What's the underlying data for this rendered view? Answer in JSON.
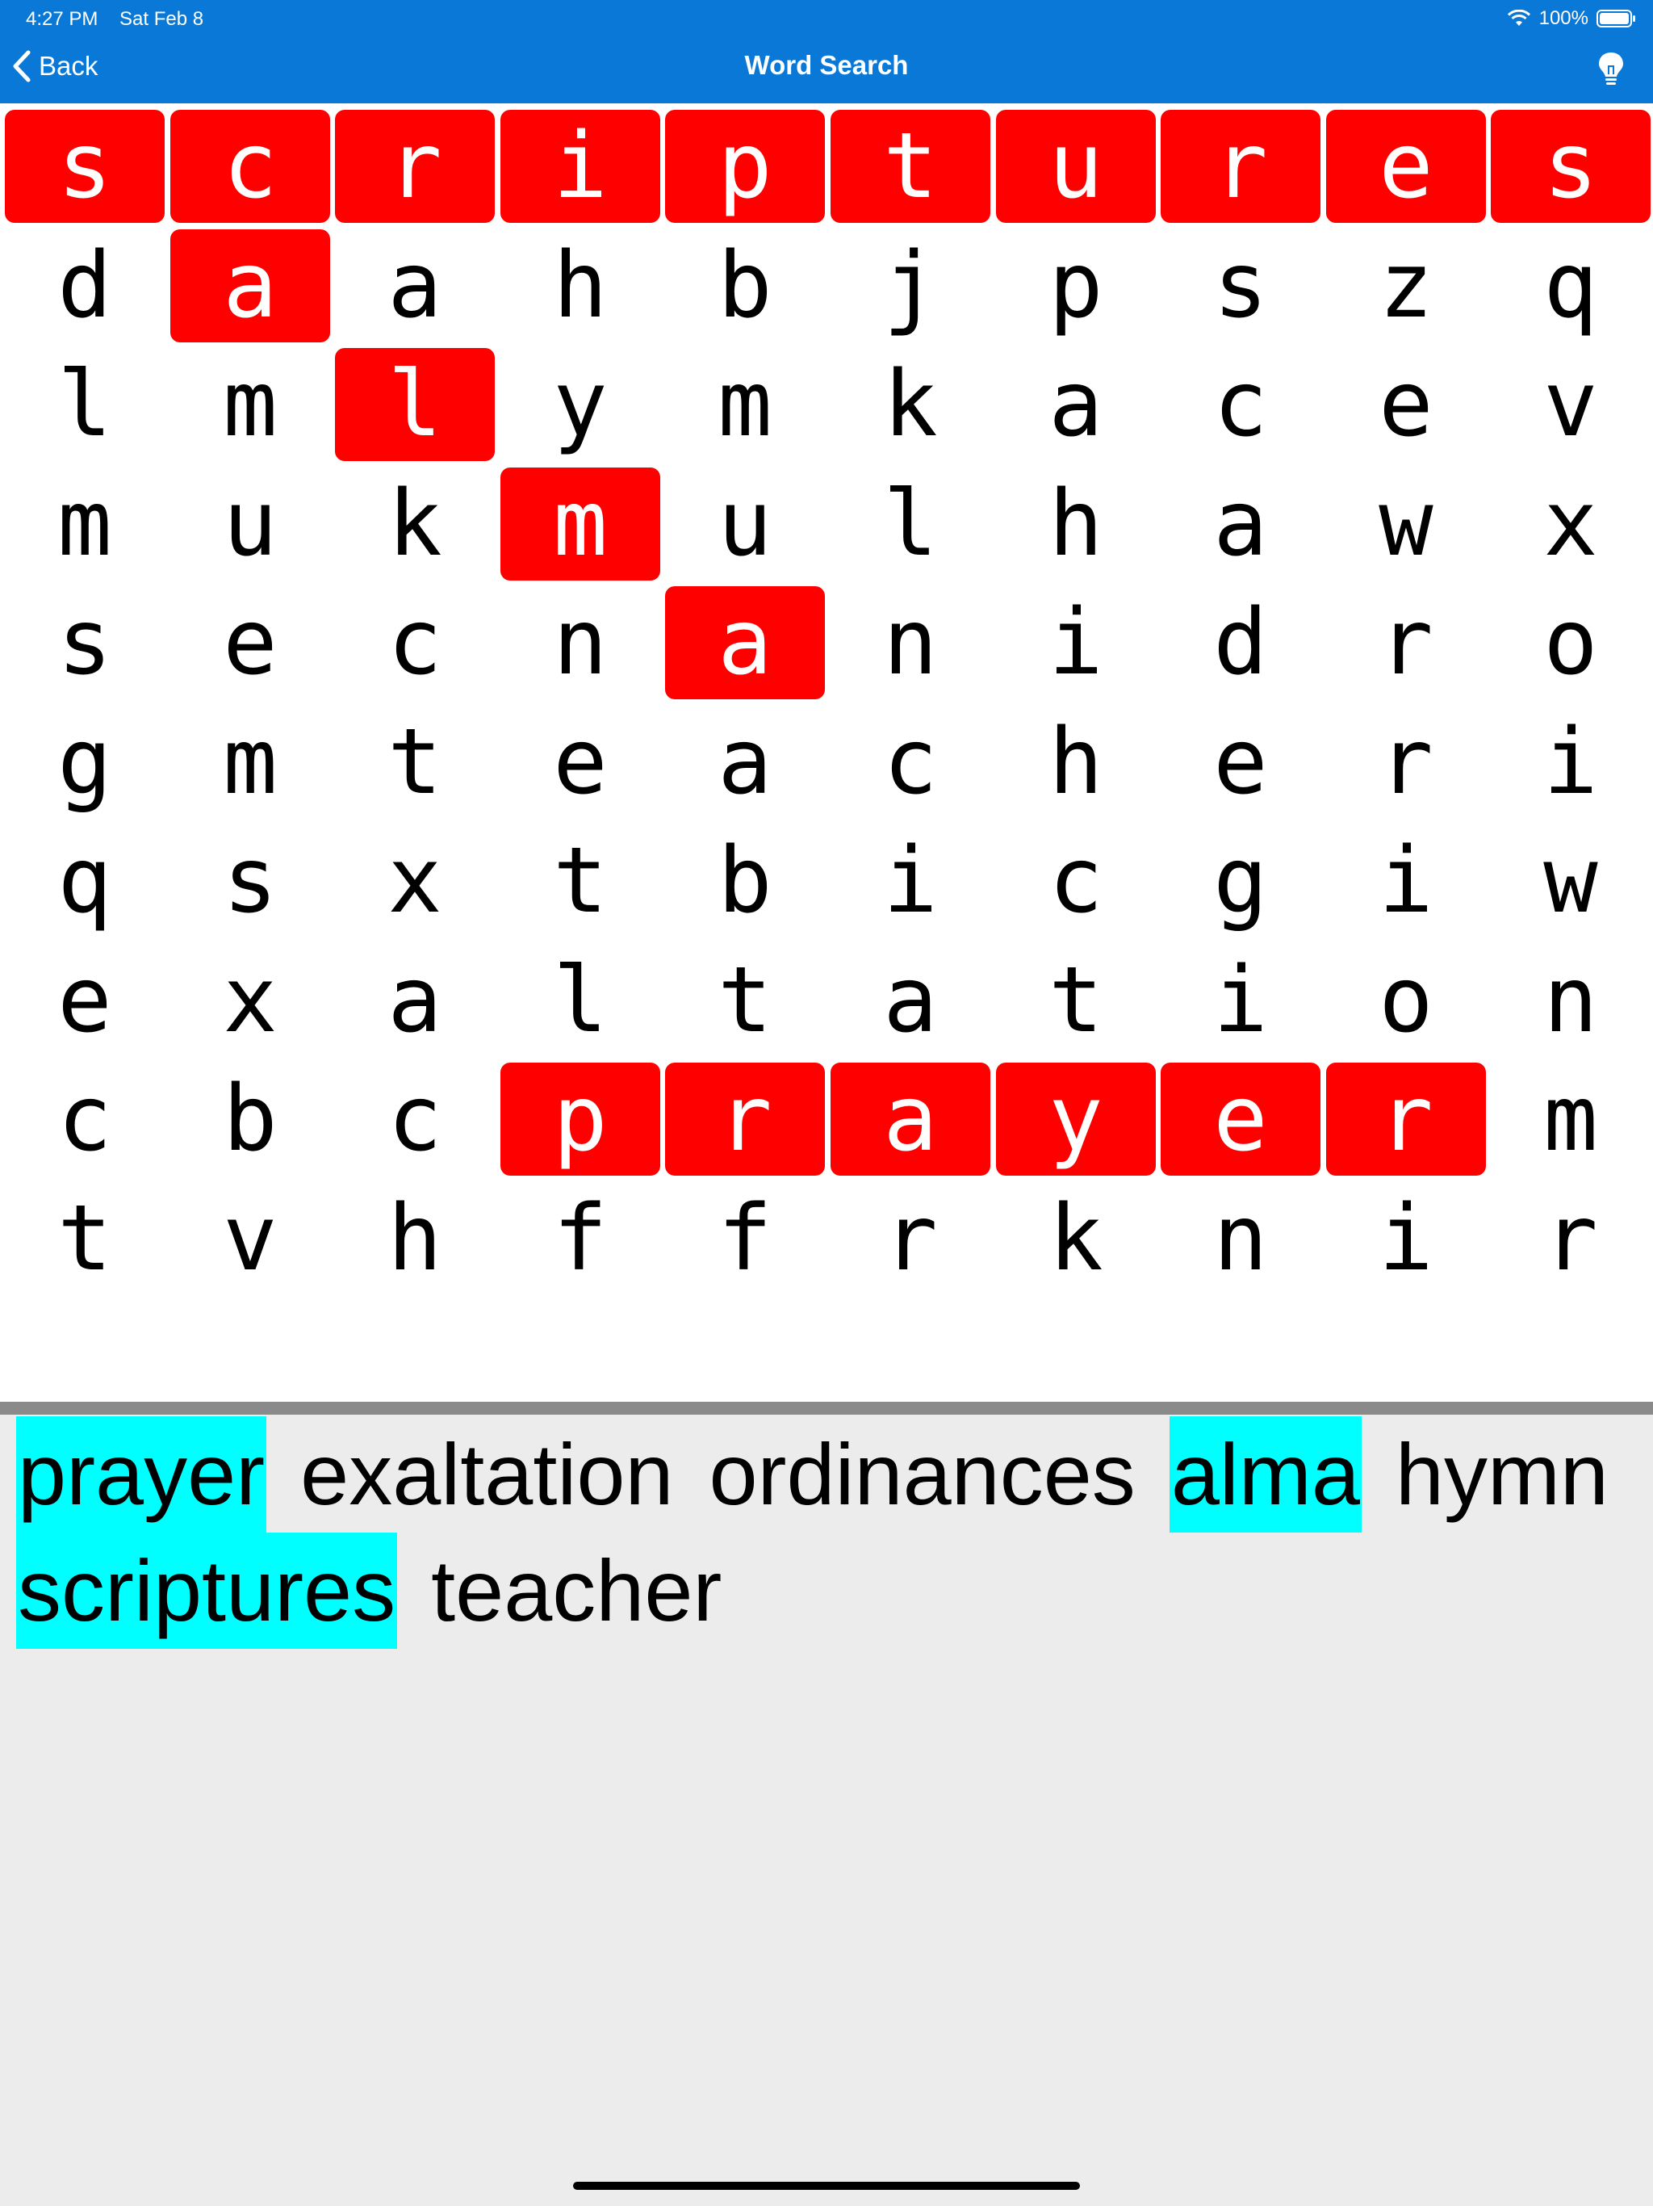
{
  "status_bar": {
    "time": "4:27 PM",
    "date": "Sat Feb 8",
    "battery": "100%",
    "battery_level": 1.0
  },
  "nav": {
    "back_label": "Back",
    "title": "Word Search",
    "hint_icon": "lightbulb-icon"
  },
  "colors": {
    "nav_bar": "#0a78d7",
    "found_cell": "#fe0000",
    "found_word": "#00ffff",
    "word_panel": "#ececec"
  },
  "grid": {
    "rows": [
      [
        "s",
        "c",
        "r",
        "i",
        "p",
        "t",
        "u",
        "r",
        "e",
        "s"
      ],
      [
        "d",
        "a",
        "a",
        "h",
        "b",
        "j",
        "p",
        "s",
        "z",
        "q"
      ],
      [
        "l",
        "m",
        "l",
        "y",
        "m",
        "k",
        "a",
        "c",
        "e",
        "v"
      ],
      [
        "m",
        "u",
        "k",
        "m",
        "u",
        "l",
        "h",
        "a",
        "w",
        "x"
      ],
      [
        "s",
        "e",
        "c",
        "n",
        "a",
        "n",
        "i",
        "d",
        "r",
        "o"
      ],
      [
        "g",
        "m",
        "t",
        "e",
        "a",
        "c",
        "h",
        "e",
        "r",
        "i"
      ],
      [
        "q",
        "s",
        "x",
        "t",
        "b",
        "i",
        "c",
        "g",
        "i",
        "w"
      ],
      [
        "e",
        "x",
        "a",
        "l",
        "t",
        "a",
        "t",
        "i",
        "o",
        "n"
      ],
      [
        "c",
        "b",
        "c",
        "p",
        "r",
        "a",
        "y",
        "e",
        "r",
        "m"
      ],
      [
        "t",
        "v",
        "h",
        "f",
        "f",
        "r",
        "k",
        "n",
        "i",
        "r"
      ]
    ],
    "found_cells": [
      [
        0,
        0
      ],
      [
        0,
        1
      ],
      [
        0,
        2
      ],
      [
        0,
        3
      ],
      [
        0,
        4
      ],
      [
        0,
        5
      ],
      [
        0,
        6
      ],
      [
        0,
        7
      ],
      [
        0,
        8
      ],
      [
        0,
        9
      ],
      [
        1,
        1
      ],
      [
        2,
        2
      ],
      [
        3,
        3
      ],
      [
        4,
        4
      ],
      [
        8,
        3
      ],
      [
        8,
        4
      ],
      [
        8,
        5
      ],
      [
        8,
        6
      ],
      [
        8,
        7
      ],
      [
        8,
        8
      ]
    ]
  },
  "words": [
    {
      "text": "prayer",
      "found": true
    },
    {
      "text": "exaltation",
      "found": false
    },
    {
      "text": "ordinances",
      "found": false
    },
    {
      "text": "alma",
      "found": true
    },
    {
      "text": "hymn",
      "found": false
    },
    {
      "text": "scriptures",
      "found": true
    },
    {
      "text": "teacher",
      "found": false
    }
  ]
}
